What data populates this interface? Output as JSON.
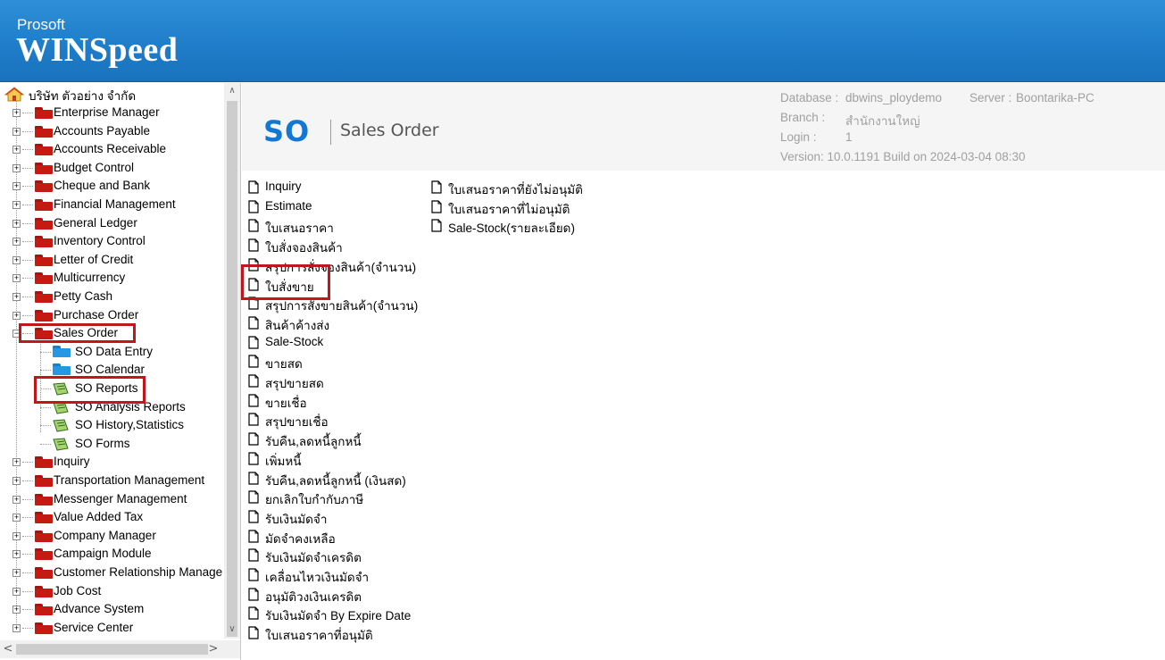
{
  "banner": {
    "brand_small": "Prosoft",
    "brand_big": "WINSpeed"
  },
  "tree": {
    "root_label": "บริษัท ตัวอย่าง จำกัด",
    "items": [
      "Enterprise Manager",
      "Accounts Payable",
      "Accounts Receivable",
      "Budget Control",
      "Cheque and Bank",
      "Financial Management",
      "General Ledger",
      "Inventory Control",
      "Letter of Credit",
      "Multicurrency",
      "Petty Cash",
      "Purchase Order",
      "Sales Order"
    ],
    "sales_order_children": [
      "SO Data Entry",
      "SO Calendar",
      "SO Reports",
      "SO Analysis Reports",
      "SO History,Statistics",
      "SO Forms"
    ],
    "items_after": [
      "Inquiry",
      "Transportation Management",
      "Messenger Management",
      "Value Added Tax",
      "Company Manager",
      "Campaign Module",
      "Customer Relationship Manage",
      "Job Cost",
      "Advance System",
      "Service Center"
    ],
    "scroll_up": "∧",
    "scroll_down": "∨",
    "scroll_left": "<",
    "scroll_right": ">"
  },
  "header": {
    "module_code": "SO",
    "module_name": "Sales Order",
    "database_label": "Database :",
    "database_value": "dbwins_ploydemo",
    "server_label": "Server :",
    "server_value": "Boontarika-PC",
    "branch_label": "Branch :",
    "branch_value": "สำนักงานใหญ่",
    "login_label": "Login :",
    "login_value": "1",
    "version_text": "Version: 10.0.1191  Build on 2024-03-04 08:30"
  },
  "reports_col1": [
    "Inquiry",
    "Estimate",
    "ใบเสนอราคา",
    "ใบสั่งจองสินค้า",
    "สรุปการสั่งจองสินค้า(จำนวน)",
    "ใบสั่งขาย",
    "สรุปการสั่งขายสินค้า(จำนวน)",
    "สินค้าค้างส่ง",
    "Sale-Stock",
    "ขายสด",
    "สรุปขายสด",
    "ขายเชื่อ",
    "สรุปขายเชื่อ",
    "รับคืน,ลดหนี้ลูกหนี้",
    "เพิ่มหนี้",
    "รับคืน,ลดหนี้ลูกหนี้ (เงินสด)",
    "ยกเลิกใบกำกับภาษี",
    "รับเงินมัดจำ",
    "มัดจำคงเหลือ",
    "รับเงินมัดจำเครดิต",
    "เคลื่อนไหวเงินมัดจำ",
    "อนุมัติวงเงินเครดิต",
    "รับเงินมัดจำ By Expire Date",
    "ใบเสนอราคาที่อนุมัติ"
  ],
  "reports_col2": [
    "ใบเสนอราคาที่ยังไม่อนุมัติ",
    "ใบเสนอราคาที่ไม่อนุมัติ",
    "Sale-Stock(รายละเอียด)"
  ],
  "colors": {
    "banner": "#1f7dc9",
    "module_code": "#1477d4",
    "highlight": "#c0161c",
    "folder": "#c51a12",
    "folder_open_child": "#2597e3"
  },
  "icons": {
    "folder": "folder-icon",
    "report": "report-icon",
    "document": "document-icon",
    "home": "home-icon"
  }
}
